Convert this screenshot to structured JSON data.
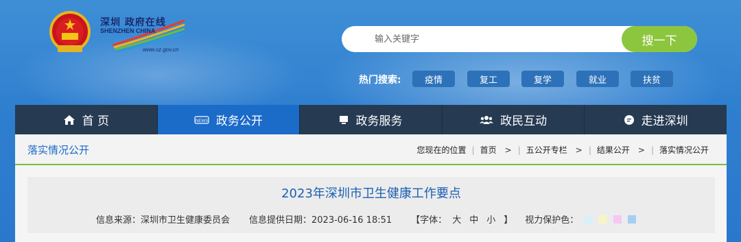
{
  "header": {
    "logo_cn": "深圳 政府在线",
    "logo_en": "SHENZHEN CHINA",
    "logo_url": "www.sz.gov.cn"
  },
  "search": {
    "placeholder": "输入关键字",
    "button_label": "搜一下",
    "hot_label": "热门搜索:",
    "hot_tags": [
      "疫情",
      "复工",
      "复学",
      "就业",
      "扶贫"
    ]
  },
  "nav": {
    "items": [
      {
        "label": "首 页",
        "icon": "home-icon"
      },
      {
        "label": "政务公开",
        "icon": "news-icon"
      },
      {
        "label": "政务服务",
        "icon": "monitor-icon"
      },
      {
        "label": "政民互动",
        "icon": "users-icon"
      },
      {
        "label": "走进深圳",
        "icon": "chat-icon"
      }
    ],
    "active_index": 1
  },
  "breadcrumb": {
    "section_title": "落实情况公开",
    "location_label": "您现在的位置",
    "items": [
      "首页",
      "五公开专栏",
      "结果公开",
      "落实情况公开"
    ]
  },
  "article": {
    "title": "2023年深圳市卫生健康工作要点",
    "source": "信息来源：深圳市卫生健康委员会",
    "date": "信息提供日期：2023-06-16 18:51",
    "font_label": "【字体：",
    "font_large": "大",
    "font_medium": "中",
    "font_small": "小",
    "font_close": "】",
    "eye_label": "视力保护色：",
    "eye_colors": [
      "#d6f1fb",
      "#f6f5c8",
      "#f7c8f4",
      "#a6cdf2"
    ]
  },
  "colors": {
    "accent": "#1b6bc9",
    "nav_bg": "#263a52",
    "search_btn": "#8cc63e",
    "divider": "#7abf3b"
  }
}
